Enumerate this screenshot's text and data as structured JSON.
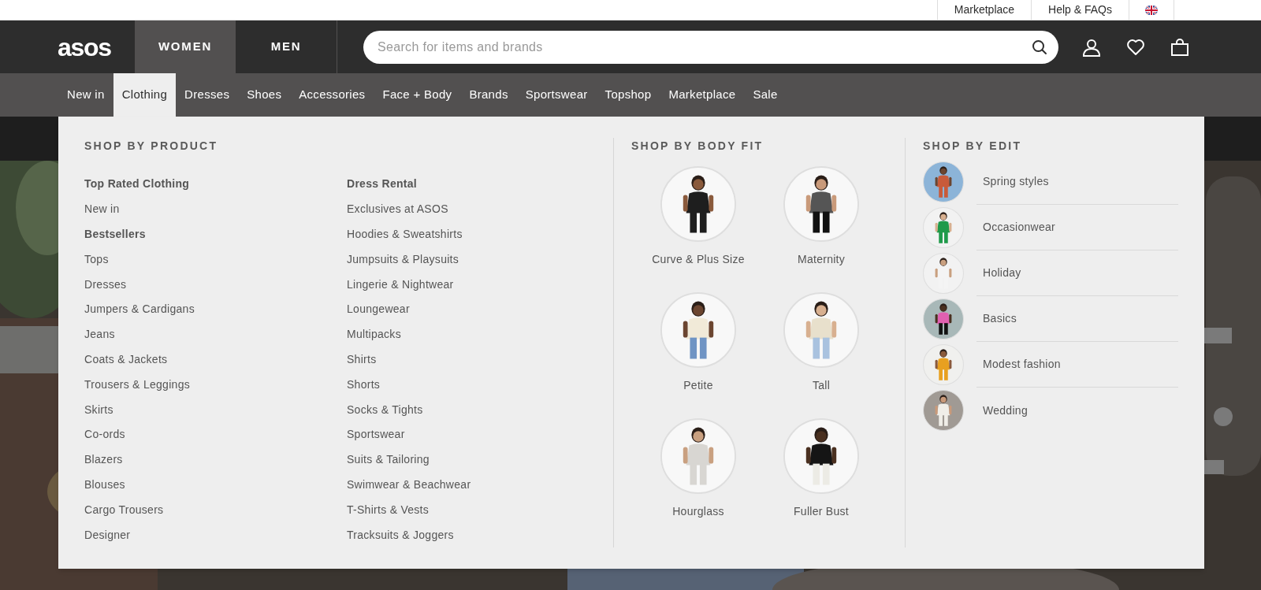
{
  "utility_links": [
    {
      "label": "Marketplace"
    },
    {
      "label": "Help & FAQs"
    }
  ],
  "logo": "asos",
  "gender_tabs": [
    {
      "label": "WOMEN",
      "selected": true
    },
    {
      "label": "MEN",
      "selected": false
    }
  ],
  "search": {
    "placeholder": "Search for items and brands"
  },
  "nav": [
    {
      "label": "New in",
      "selected": false
    },
    {
      "label": "Clothing",
      "selected": true
    },
    {
      "label": "Dresses",
      "selected": false
    },
    {
      "label": "Shoes",
      "selected": false
    },
    {
      "label": "Accessories",
      "selected": false
    },
    {
      "label": "Face + Body",
      "selected": false
    },
    {
      "label": "Brands",
      "selected": false
    },
    {
      "label": "Sportswear",
      "selected": false
    },
    {
      "label": "Topshop",
      "selected": false
    },
    {
      "label": "Marketplace",
      "selected": false
    },
    {
      "label": "Sale",
      "selected": false
    }
  ],
  "menu": {
    "product": {
      "heading": "SHOP BY PRODUCT",
      "columns": [
        [
          {
            "label": "Top Rated Clothing",
            "bold": true
          },
          {
            "label": "New in",
            "bold": false
          },
          {
            "label": "Bestsellers",
            "bold": true
          },
          {
            "label": "Tops",
            "bold": false
          },
          {
            "label": "Dresses",
            "bold": false
          },
          {
            "label": "Jumpers & Cardigans",
            "bold": false
          },
          {
            "label": "Jeans",
            "bold": false
          },
          {
            "label": "Coats & Jackets",
            "bold": false
          },
          {
            "label": "Trousers & Leggings",
            "bold": false
          },
          {
            "label": "Skirts",
            "bold": false
          },
          {
            "label": "Co-ords",
            "bold": false
          },
          {
            "label": "Blazers",
            "bold": false
          },
          {
            "label": "Blouses",
            "bold": false
          },
          {
            "label": "Cargo Trousers",
            "bold": false
          },
          {
            "label": "Designer",
            "bold": false
          }
        ],
        [
          {
            "label": "Dress Rental",
            "bold": true
          },
          {
            "label": "Exclusives at ASOS",
            "bold": false
          },
          {
            "label": "Hoodies & Sweatshirts",
            "bold": false
          },
          {
            "label": "Jumpsuits & Playsuits",
            "bold": false
          },
          {
            "label": "Lingerie & Nightwear",
            "bold": false
          },
          {
            "label": "Loungewear",
            "bold": false
          },
          {
            "label": "Multipacks",
            "bold": false
          },
          {
            "label": "Shirts",
            "bold": false
          },
          {
            "label": "Shorts",
            "bold": false
          },
          {
            "label": "Socks & Tights",
            "bold": false
          },
          {
            "label": "Sportswear",
            "bold": false
          },
          {
            "label": "Suits & Tailoring",
            "bold": false
          },
          {
            "label": "Swimwear & Beachwear",
            "bold": false
          },
          {
            "label": "T-Shirts & Vests",
            "bold": false
          },
          {
            "label": "Tracksuits & Joggers",
            "bold": false
          }
        ]
      ]
    },
    "body_fit": {
      "heading": "SHOP BY BODY FIT",
      "items": [
        {
          "label": "Curve & Plus Size"
        },
        {
          "label": "Maternity"
        },
        {
          "label": "Petite"
        },
        {
          "label": "Tall"
        },
        {
          "label": "Hourglass"
        },
        {
          "label": "Fuller Bust"
        }
      ]
    },
    "edit": {
      "heading": "SHOP BY EDIT",
      "items": [
        {
          "label": "Spring styles"
        },
        {
          "label": "Occasionwear"
        },
        {
          "label": "Holiday"
        },
        {
          "label": "Basics"
        },
        {
          "label": "Modest fashion"
        },
        {
          "label": "Wedding"
        }
      ]
    }
  }
}
